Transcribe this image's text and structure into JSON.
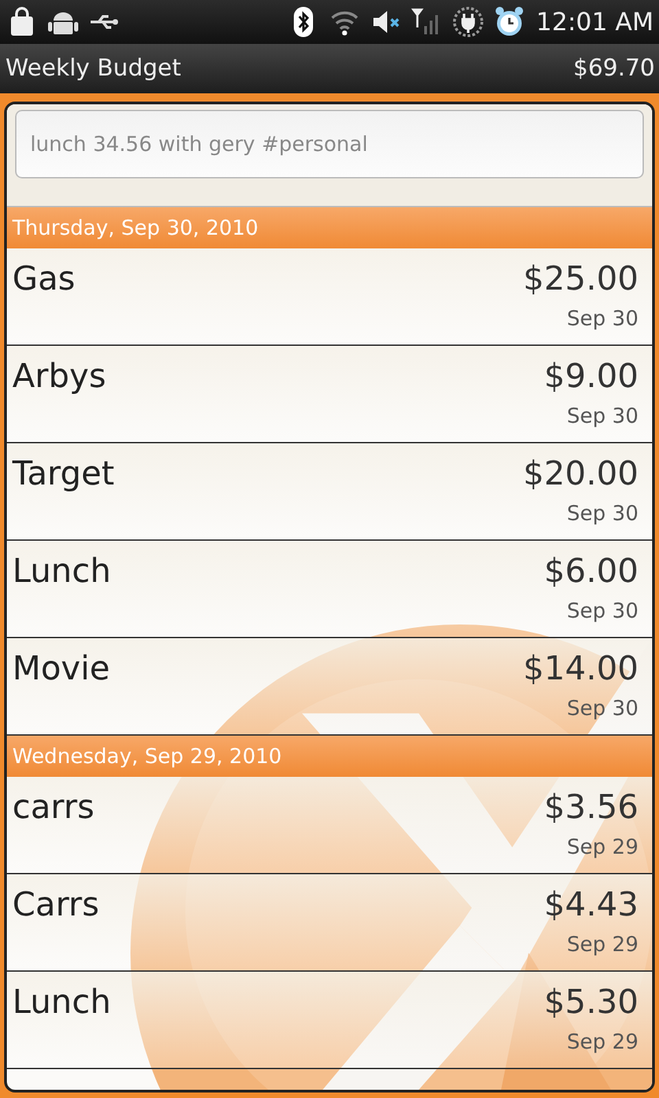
{
  "status_bar": {
    "time": "12:01 AM"
  },
  "title_bar": {
    "title": "Weekly Budget",
    "total": "$69.70"
  },
  "entry": {
    "placeholder": "lunch 34.56 with gery #personal"
  },
  "groups": [
    {
      "header": "Thursday, Sep 30, 2010",
      "items": [
        {
          "name": "Gas",
          "amount": "$25.00",
          "date": "Sep 30"
        },
        {
          "name": "Arbys",
          "amount": "$9.00",
          "date": "Sep 30"
        },
        {
          "name": "Target",
          "amount": "$20.00",
          "date": "Sep 30"
        },
        {
          "name": "Lunch",
          "amount": "$6.00",
          "date": "Sep 30"
        },
        {
          "name": "Movie",
          "amount": "$14.00",
          "date": "Sep 30"
        }
      ]
    },
    {
      "header": "Wednesday, Sep 29, 2010",
      "items": [
        {
          "name": "carrs",
          "amount": "$3.56",
          "date": "Sep 29"
        },
        {
          "name": "Carrs",
          "amount": "$4.43",
          "date": "Sep 29"
        },
        {
          "name": "Lunch",
          "amount": "$5.30",
          "date": "Sep 29"
        }
      ]
    }
  ]
}
